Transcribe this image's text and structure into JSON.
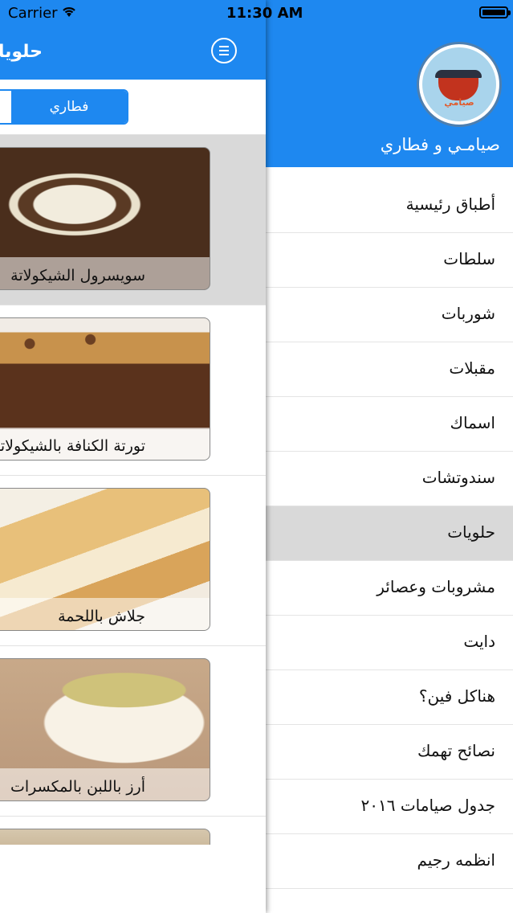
{
  "status_bar": {
    "carrier": "Carrier",
    "time": "11:30 AM"
  },
  "header": {
    "title": "حلويات",
    "menu_icon": "hamburger-icon"
  },
  "segmented": {
    "selected_label": "فطاري"
  },
  "recipes": [
    {
      "caption": "سويسرول الشيكولاتة"
    },
    {
      "caption": "تورتة الكنافة بالشيكولاتة"
    },
    {
      "caption": "جلاش باللحمة"
    },
    {
      "caption": "أرز باللبن بالمكسرات"
    }
  ],
  "drawer": {
    "app_name": "صيامـي و فطاري",
    "logo_text": "صيامي",
    "menu_items": [
      {
        "label": "أطباق رئيسية"
      },
      {
        "label": "سلطات"
      },
      {
        "label": "شوربات"
      },
      {
        "label": "مقبلات"
      },
      {
        "label": "اسماك"
      },
      {
        "label": "سندوتشات"
      },
      {
        "label": "حلويات",
        "active": true
      },
      {
        "label": "مشروبات وعصائر"
      },
      {
        "label": "دايت"
      },
      {
        "label": "هناكل فين؟"
      },
      {
        "label": "نصائح تهمك"
      },
      {
        "label": "جدول صيامات ٢٠١٦"
      },
      {
        "label": "انظمه رجيم"
      }
    ]
  },
  "colors": {
    "accent": "#1e88f0",
    "selected_row": "#d9d9d9"
  }
}
